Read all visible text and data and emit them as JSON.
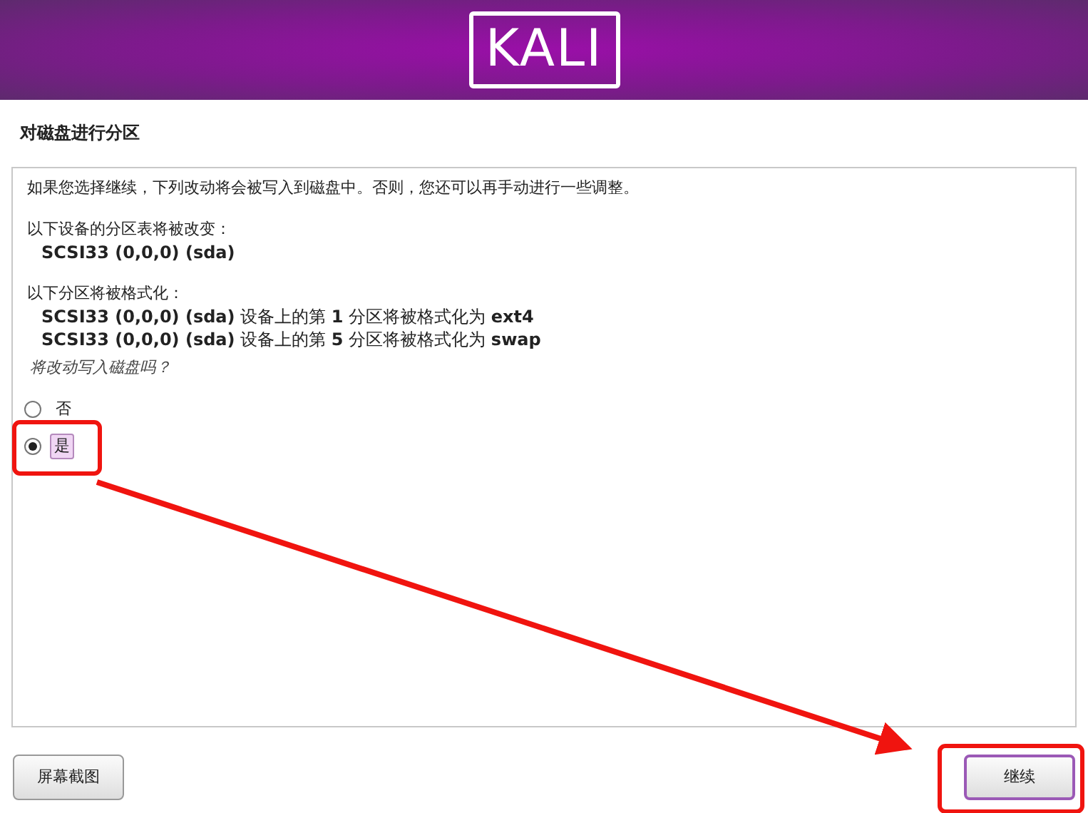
{
  "header": {
    "logo": "KALI"
  },
  "title": "对磁盘进行分区",
  "panel": {
    "intro": "如果您选择继续，下列改动将会被写入到磁盘中。否则，您还可以再手动进行一些调整。",
    "sections": [
      {
        "label": "以下设备的分区表将被改变：",
        "items": [
          "**SCSI33 (0,0,0) (sda)**"
        ]
      },
      {
        "label": "以下分区将被格式化：",
        "items": [
          "**SCSI33 (0,0,0) (sda)** 设备上的第 **1** 分区将被格式化为 **ext4**",
          "**SCSI33 (0,0,0) (sda)** 设备上的第 **5** 分区将被格式化为 **swap**"
        ]
      }
    ],
    "question": "将改动写入磁盘吗？",
    "options": [
      {
        "label": "否",
        "selected": false
      },
      {
        "label": "是",
        "selected": true
      }
    ]
  },
  "buttons": [
    {
      "label": "屏幕截图",
      "default": false
    },
    {
      "label": "继续",
      "default": true
    }
  ]
}
